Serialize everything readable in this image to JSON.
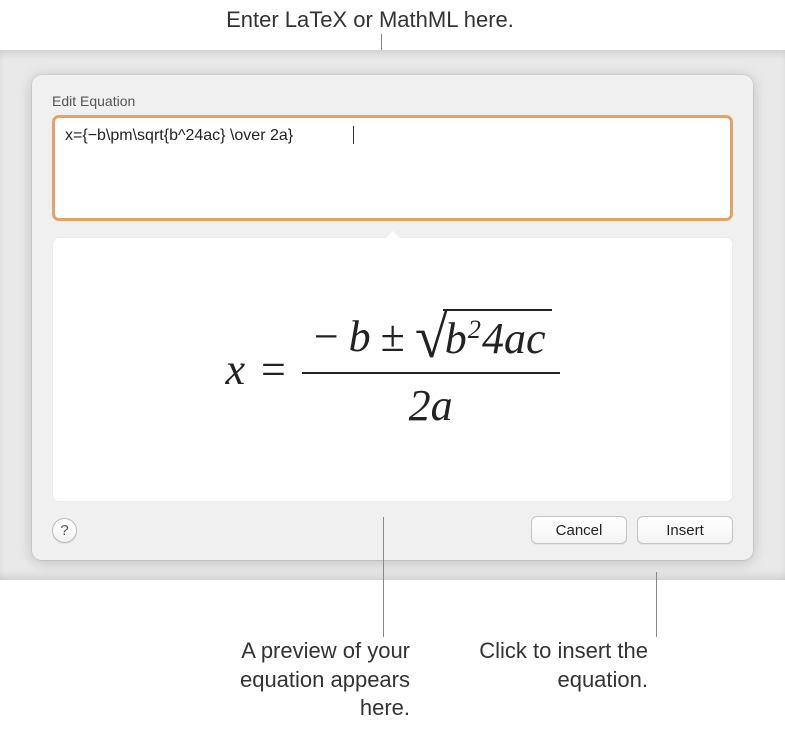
{
  "annotations": {
    "top": "Enter LaTeX or MathML here.",
    "bottom_left": "A preview of your equation appears here.",
    "bottom_right": "Click to insert the equation."
  },
  "dialog": {
    "title": "Edit Equation",
    "input_value": "x={−b\\pm\\sqrt{b^24ac} \\over 2a}",
    "help_label": "?",
    "cancel_label": "Cancel",
    "insert_label": "Insert"
  },
  "preview": {
    "lhs": "x",
    "equals": "=",
    "numerator_minus": "−",
    "numerator_b": "b",
    "plus_minus": "±",
    "radicand_b": "b",
    "radicand_exp": "2",
    "radicand_4ac": "4ac",
    "denominator": "2a"
  }
}
